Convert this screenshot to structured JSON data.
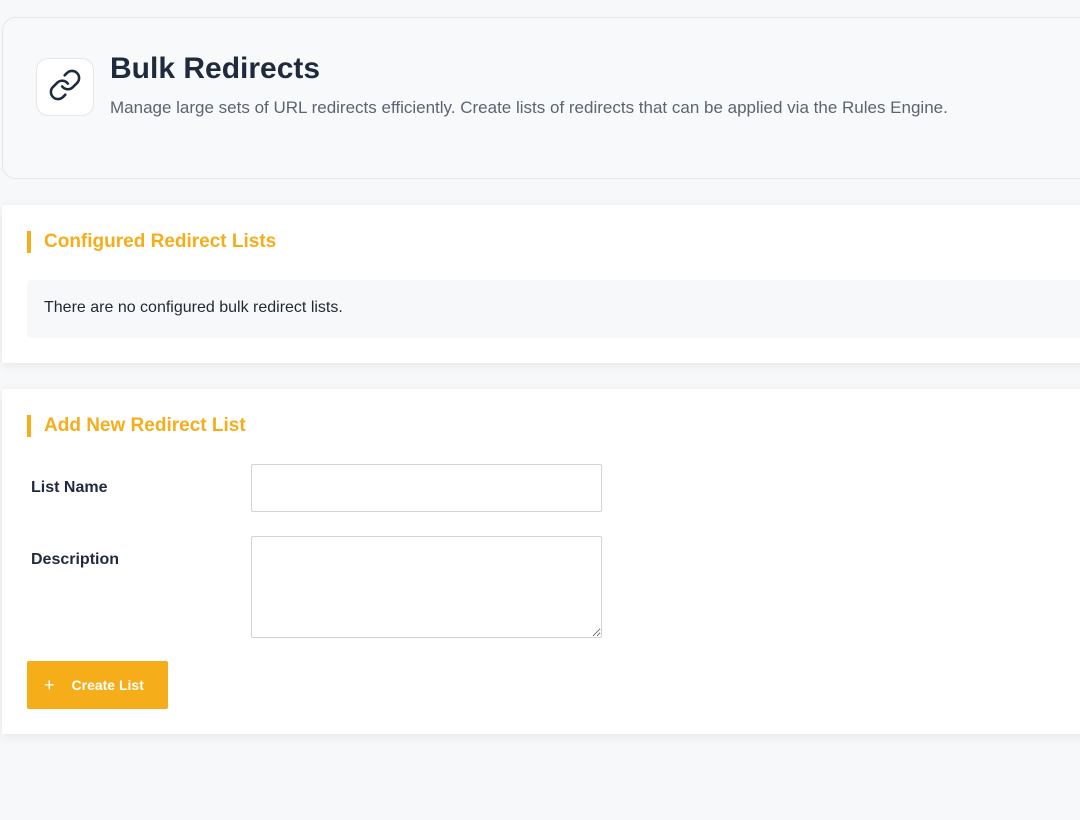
{
  "header": {
    "icon": "link-icon",
    "title": "Bulk Redirects",
    "subtitle": "Manage large sets of URL redirects efficiently. Create lists of redirects that can be applied via the Rules Engine."
  },
  "configured": {
    "title": "Configured Redirect Lists",
    "empty_message": "There are no configured bulk redirect lists."
  },
  "add_new": {
    "title": "Add New Redirect List",
    "list_name_label": "List Name",
    "list_name_value": "",
    "description_label": "Description",
    "description_value": "",
    "create_button_icon": "plus-icon",
    "create_button_label": "Create List"
  },
  "colors": {
    "accent": "#f6ad1a",
    "title_text": "#1f2a3c",
    "muted_text": "#5b6471",
    "background": "#f7f8fa"
  }
}
